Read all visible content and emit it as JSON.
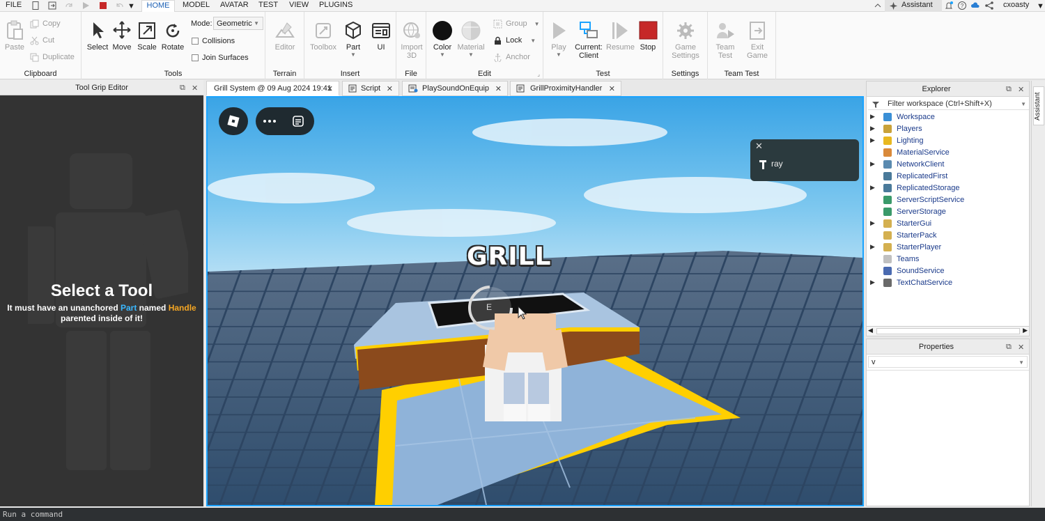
{
  "menubar": {
    "file": "FILE",
    "tabs": [
      "HOME",
      "MODEL",
      "AVATAR",
      "TEST",
      "VIEW",
      "PLUGINS"
    ],
    "assistant": "Assistant",
    "user": "cxoasty"
  },
  "ribbon": {
    "clipboard": {
      "label": "Clipboard",
      "paste": "Paste",
      "copy": "Copy",
      "cut": "Cut",
      "duplicate": "Duplicate"
    },
    "tools": {
      "label": "Tools",
      "select": "Select",
      "move": "Move",
      "scale": "Scale",
      "rotate": "Rotate",
      "mode_label": "Mode:",
      "mode_value": "Geometric",
      "collisions": "Collisions",
      "join_surfaces": "Join Surfaces"
    },
    "terrain": {
      "label": "Terrain",
      "editor": "Editor"
    },
    "insert": {
      "label": "Insert",
      "toolbox": "Toolbox",
      "part": "Part",
      "ui": "UI"
    },
    "file": {
      "label": "File",
      "import_line1": "Import",
      "import_line2": "3D"
    },
    "edit": {
      "label": "Edit",
      "color": "Color",
      "material": "Material",
      "group": "Group",
      "lock": "Lock",
      "anchor": "Anchor"
    },
    "test": {
      "label": "Test",
      "play": "Play",
      "current_line1": "Current:",
      "current_line2": "Client",
      "resume": "Resume",
      "stop": "Stop"
    },
    "settings": {
      "label": "Settings",
      "game_line1": "Game",
      "game_line2": "Settings"
    },
    "team_test": {
      "label": "Team Test",
      "team_line1": "Team",
      "team_line2": "Test",
      "exit_line1": "Exit",
      "exit_line2": "Game"
    }
  },
  "left_panel": {
    "title": "Tool Grip Editor",
    "heading": "Select a Tool",
    "sub_prefix": "It must have an unanchored ",
    "sub_part": "Part",
    "sub_mid": " named ",
    "sub_handle": "Handle",
    "sub_suffix": "parented inside of it!"
  },
  "doc_tabs": [
    "Grill System @ 09 Aug 2024 19:41",
    "Script",
    "PlaySoundOnEquip",
    "GrillProximityHandler"
  ],
  "viewport": {
    "billboard": "GRILL",
    "prompt_key": "E",
    "chat_name": "ray"
  },
  "explorer": {
    "title": "Explorer",
    "filter_placeholder": "Filter workspace (Ctrl+Shift+X)",
    "items": [
      {
        "label": "Workspace",
        "expandable": true,
        "color": "#3a8fd6"
      },
      {
        "label": "Players",
        "expandable": true,
        "color": "#c9a23a"
      },
      {
        "label": "Lighting",
        "expandable": true,
        "color": "#e8b820"
      },
      {
        "label": "MaterialService",
        "expandable": false,
        "color": "#d9893a"
      },
      {
        "label": "NetworkClient",
        "expandable": true,
        "color": "#5a8ab0"
      },
      {
        "label": "ReplicatedFirst",
        "expandable": false,
        "color": "#4a7a9a"
      },
      {
        "label": "ReplicatedStorage",
        "expandable": true,
        "color": "#4a7a9a"
      },
      {
        "label": "ServerScriptService",
        "expandable": false,
        "color": "#3a9a6a"
      },
      {
        "label": "ServerStorage",
        "expandable": false,
        "color": "#3a9a6a"
      },
      {
        "label": "StarterGui",
        "expandable": true,
        "color": "#d4b050"
      },
      {
        "label": "StarterPack",
        "expandable": false,
        "color": "#d4b050"
      },
      {
        "label": "StarterPlayer",
        "expandable": true,
        "color": "#d4b050"
      },
      {
        "label": "Teams",
        "expandable": false,
        "color": "#c0c0c0"
      },
      {
        "label": "SoundService",
        "expandable": false,
        "color": "#4a6ab0"
      },
      {
        "label": "TextChatService",
        "expandable": true,
        "color": "#6a6a6a"
      }
    ]
  },
  "properties": {
    "title": "Properties",
    "filter_value": "v"
  },
  "side_tab": "Assistant",
  "command_bar": {
    "placeholder": "Run a command"
  },
  "colors": {
    "accent": "#1aa3ff",
    "stop": "#c62828",
    "sky_top": "#5db6e8",
    "baseplate": "#3d5a78",
    "yellow_border": "#ffcf00"
  }
}
